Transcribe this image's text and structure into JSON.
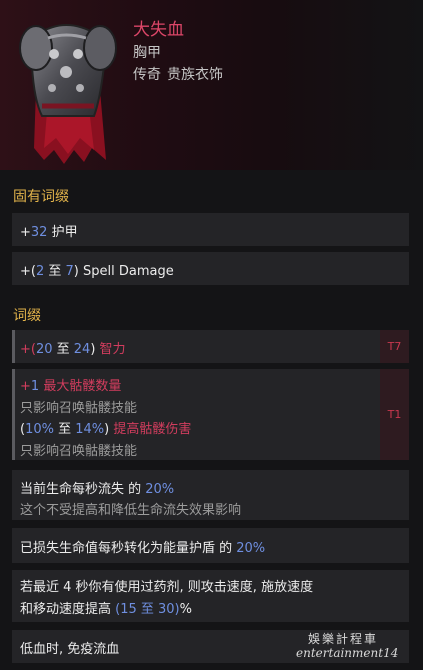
{
  "item": {
    "name": "大失血",
    "type": "胸甲",
    "rarity": "传奇",
    "base": "贵族衣饰"
  },
  "implicit": {
    "title": "固有词缀",
    "rows": [
      {
        "a": "+",
        "b": "32",
        "c": " 护甲"
      },
      {
        "a": "+(",
        "b": "2",
        "c": " 至 ",
        "d": "7",
        "e": ") Spell Damage"
      }
    ]
  },
  "affixes": {
    "title": "词缀",
    "intelligence": {
      "a": "+(",
      "b": "20",
      "c": " 至 ",
      "d": "24",
      "e": ") ",
      "f": "智力",
      "tier": "T7"
    },
    "minion": {
      "l1a": "+",
      "l1b": "1",
      "l1c": " 最大骷髅数量",
      "l2": "只影响召唤骷髅技能",
      "l3a": "(",
      "l3b": "10%",
      "l3c": " 至 ",
      "l3d": "14%",
      "l3e": ") ",
      "l3f": "提高骷髅伤害",
      "l4": "只影响召唤骷髅技能",
      "tier": "T1"
    },
    "unique1": {
      "a": "当前生命每秒流失 的 ",
      "b": "20%",
      "note": "这个不受提高和降低生命流失效果影响"
    },
    "unique2": {
      "a": "已损失生命值每秒转化为能量护盾 的 ",
      "b": "20%"
    },
    "unique3": {
      "l1": "若最近 4 秒你有使用过药剂, 则攻击速度, 施放速度",
      "l2a": "和移动速度提高 ",
      "l2b": "(15 至 30)",
      "l2c": "%"
    },
    "unique4": {
      "a": "低血时, 免疫流血"
    }
  },
  "watermark": {
    "line1": "娛樂計程車",
    "line2": "entertainment14"
  },
  "colors": {
    "name": "#dc4668",
    "section": "#e0b24a",
    "value": "#6f8fe0",
    "affix_red": "#d23d5e"
  }
}
